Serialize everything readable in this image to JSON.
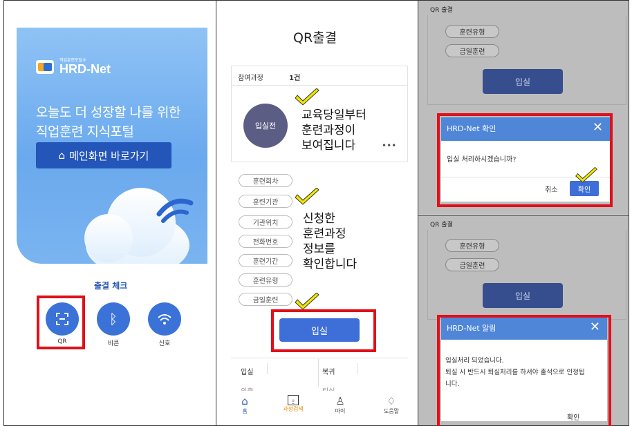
{
  "panel1": {
    "logo_small": "직업훈련포털®",
    "logo_big": "HRD-Net",
    "hero_line1": "오늘도 더 성장할 나를 위한",
    "hero_line2": "직업훈련 지식포털",
    "main_button": "메인화면 바로가기",
    "check_title": "출결 체크",
    "methods": [
      {
        "label": "QR",
        "icon": "qr-scan-icon"
      },
      {
        "label": "비콘",
        "icon": "bluetooth-icon"
      },
      {
        "label": "신호",
        "icon": "wifi-icon"
      }
    ]
  },
  "panel2": {
    "title": "QR출결",
    "course_label": "참여과정",
    "course_count": "1건",
    "status": "입실전",
    "more": "•••",
    "annotation1": [
      "교육당일부터",
      "훈련과정이",
      "보여집니다"
    ],
    "annotation2": [
      "신청한",
      "훈련과정",
      "정보를",
      "확인합니다"
    ],
    "fields": [
      "훈련회차",
      "훈련기관",
      "기관위치",
      "전화번호",
      "훈련기간",
      "훈련유형",
      "금일훈련"
    ],
    "checkin_button": "입실",
    "table": {
      "r1c1": "입실",
      "r1c2": "복귀",
      "r2c1": "외출",
      "r2c2": "퇴실"
    },
    "tabs": [
      {
        "label": "홈",
        "icon": "home-icon"
      },
      {
        "label": "과정검색",
        "icon": "search-doc-icon"
      },
      {
        "label": "마이",
        "icon": "person-icon"
      },
      {
        "label": "도움말",
        "icon": "bell-icon"
      }
    ]
  },
  "panel3": {
    "header": "QR 출결",
    "pill1": "훈련유형",
    "pill2": "금일훈련",
    "bg_button": "입실",
    "modal_title": "HRD-Net 확인",
    "modal_body": "입실 처리하시겠습니까?",
    "cancel": "취소",
    "confirm": "확인"
  },
  "panel4": {
    "header": "QR 출결",
    "pill1": "훈련유형",
    "pill2": "금일훈련",
    "bg_button": "입실",
    "modal_title": "HRD-Net 알림",
    "line1": "입실처리 되었습니다.",
    "line2": "퇴실 시 반드시 퇴실처리를 하셔야 출석으로 인정됩",
    "line3": "니다.",
    "confirm": "확인"
  },
  "colors": {
    "accent": "#3e6fd8",
    "highlight": "#e0101a",
    "check": "#f2e600"
  }
}
